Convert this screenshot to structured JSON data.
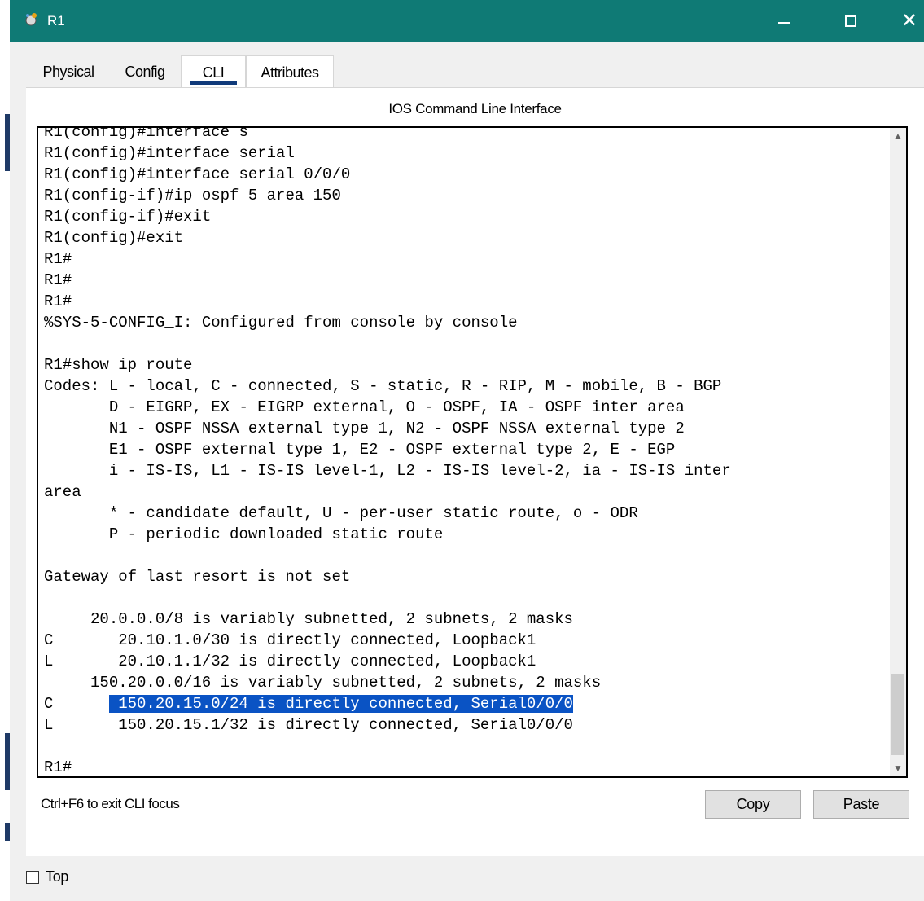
{
  "window": {
    "title": "R1",
    "controls": {
      "minimize": "minimize-icon",
      "maximize": "maximize-icon",
      "close": "close-icon"
    }
  },
  "tabs": [
    {
      "label": "Physical",
      "active": false
    },
    {
      "label": "Config",
      "active": false
    },
    {
      "label": "CLI",
      "active": true
    },
    {
      "label": "Attributes",
      "active": false
    }
  ],
  "panel": {
    "title": "IOS Command Line Interface"
  },
  "terminal": {
    "lines": [
      "R1(config)#interface s",
      "R1(config)#interface serial",
      "R1(config)#interface serial 0/0/0",
      "R1(config-if)#ip ospf 5 area 150",
      "R1(config-if)#exit",
      "R1(config)#exit",
      "R1#",
      "R1#",
      "R1#",
      "%SYS-5-CONFIG_I: Configured from console by console",
      "",
      "R1#show ip route",
      "Codes: L - local, C - connected, S - static, R - RIP, M - mobile, B - BGP",
      "       D - EIGRP, EX - EIGRP external, O - OSPF, IA - OSPF inter area",
      "       N1 - OSPF NSSA external type 1, N2 - OSPF NSSA external type 2",
      "       E1 - OSPF external type 1, E2 - OSPF external type 2, E - EGP",
      "       i - IS-IS, L1 - IS-IS level-1, L2 - IS-IS level-2, ia - IS-IS inter",
      "area",
      "       * - candidate default, U - per-user static route, o - ODR",
      "       P - periodic downloaded static route",
      "",
      "Gateway of last resort is not set",
      "",
      "     20.0.0.0/8 is variably subnetted, 2 subnets, 2 masks",
      "C       20.10.1.0/30 is directly connected, Loopback1",
      "L       20.10.1.1/32 is directly connected, Loopback1",
      "     150.20.0.0/16 is variably subnetted, 2 subnets, 2 masks",
      "C       150.20.15.0/24 is directly connected, Serial0/0/0",
      "L       150.20.15.1/32 is directly connected, Serial0/0/0",
      "",
      "R1#"
    ],
    "highlight": {
      "line_index": 27,
      "text": " 150.20.15.0/24 is directly connected, Serial0/0/0"
    }
  },
  "footer": {
    "hint": "Ctrl+F6 to exit CLI focus",
    "copy_label": "Copy",
    "paste_label": "Paste"
  },
  "top_checkbox": {
    "label": "Top",
    "checked": false
  },
  "colors": {
    "titlebar": "#0f7a75",
    "selection": "#0a53c4",
    "tab_underline": "#103a7a"
  }
}
